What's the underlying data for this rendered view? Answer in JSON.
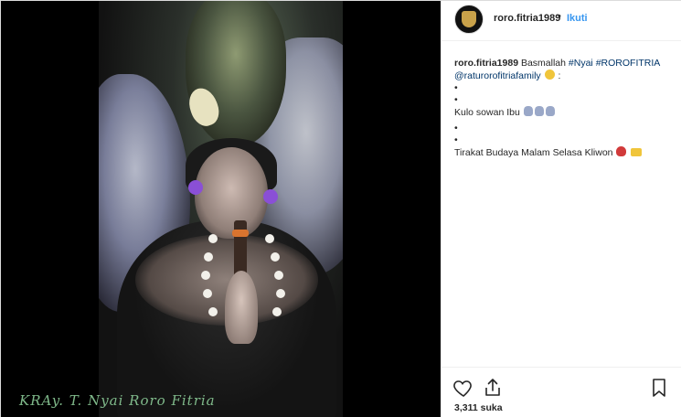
{
  "header": {
    "username": "roro.fitria1989",
    "separator": "•",
    "follow_label": "Ikuti"
  },
  "caption": {
    "username": "roro.fitria1989",
    "line1_text": "Basmallah",
    "tag1": "#Nyai",
    "tag2": "#ROROFITRIA",
    "mention": "@raturorofitriafamily",
    "colon": ":",
    "bullet": "•",
    "kulo": "Kulo sowan Ibu",
    "tirakat": "Tirakat Budaya Malam Selasa Kliwon"
  },
  "media": {
    "watermark": "KRAy. T. Nyai Roro Fitria"
  },
  "actions": {
    "likes": "3,311 suka"
  },
  "icons": [
    "heart-icon",
    "share-icon",
    "bookmark-icon"
  ],
  "colors": {
    "link": "#003569",
    "follow": "#3897f0",
    "text": "#262626",
    "watermark": "#7fb98a"
  }
}
